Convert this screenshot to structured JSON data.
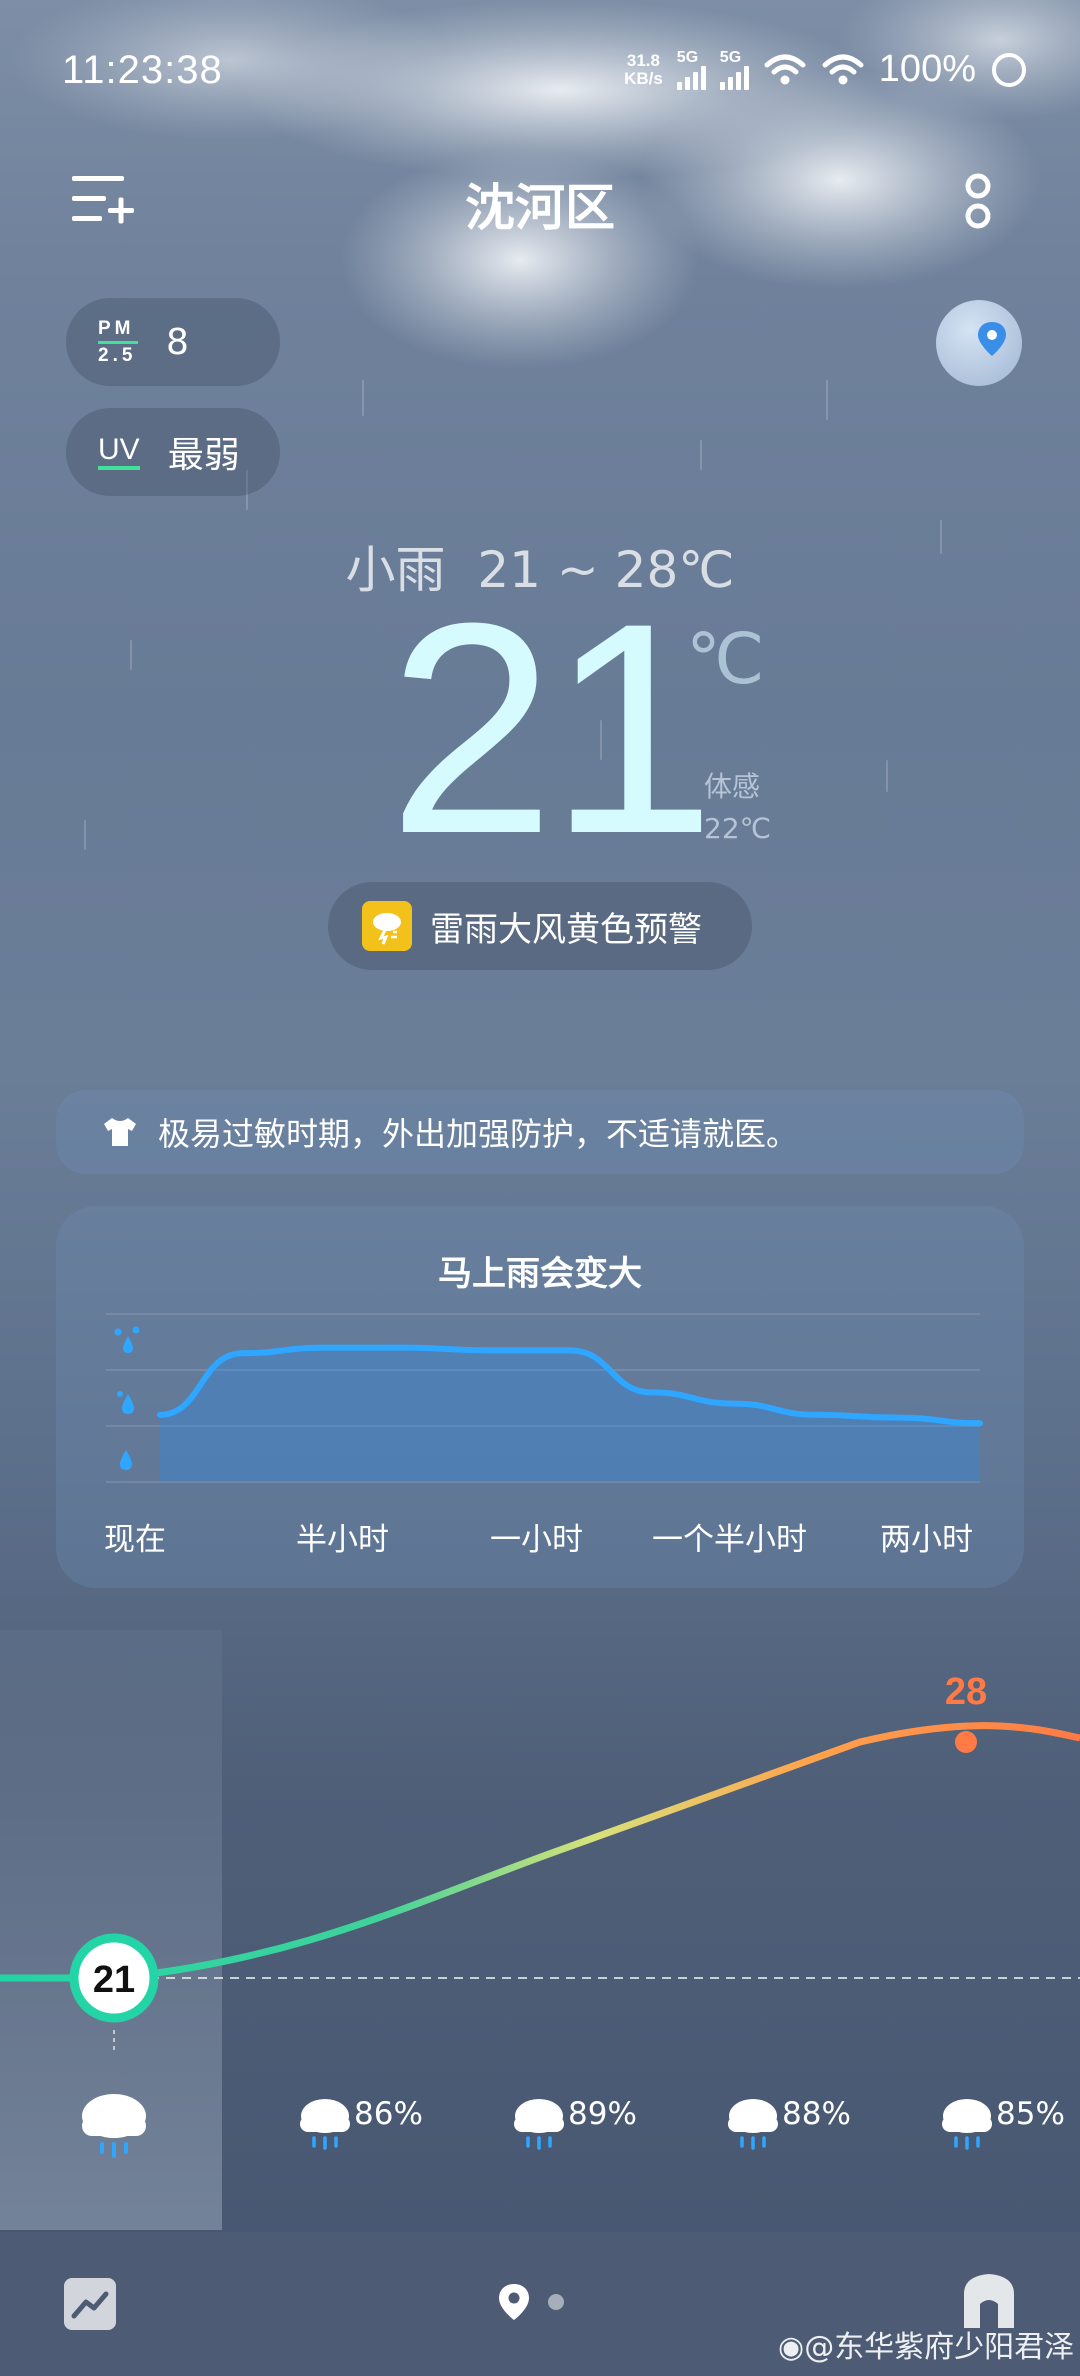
{
  "status_bar": {
    "time": "11:23:38",
    "net_speed_value": "31.8",
    "net_speed_unit": "KB/s",
    "sim1": "5G",
    "sim2": "5G",
    "battery": "100%"
  },
  "header": {
    "city": "沈河区"
  },
  "air": {
    "pm_label_top": "PM",
    "pm_label_bottom": "2.5",
    "pm_value": "8",
    "uv_label": "UV",
    "uv_value": "最弱"
  },
  "current": {
    "condition": "小雨",
    "range": "21 ~ 28℃",
    "temperature": "21",
    "unit": "℃",
    "feels_label": "体感",
    "feels_value": "22℃",
    "warning": "雷雨大风黄色预警"
  },
  "tip": {
    "text": "极易过敏时期，外出加强防护，不适请就医。"
  },
  "rain_forecast": {
    "title": "马上雨会变大",
    "x_labels": [
      "现在",
      "半小时",
      "一小时",
      "一个半小时",
      "两小时"
    ]
  },
  "chart_data": {
    "type": "area",
    "title": "马上雨会变大",
    "x": [
      "现在",
      "半小时",
      "一小时",
      "一个半小时",
      "两小时"
    ],
    "y_levels": [
      "小雨",
      "中雨",
      "大雨"
    ],
    "series": [
      {
        "values": [
          1.2,
          2.3,
          2.4,
          2.4,
          2.35,
          2.35,
          1.6,
          1.4,
          1.2,
          1.15,
          1.05
        ]
      }
    ],
    "grid": true
  },
  "hourly": {
    "now_temp": "21",
    "max_temp": "28",
    "items": [
      {
        "pct": ""
      },
      {
        "pct": "86%"
      },
      {
        "pct": "89%"
      },
      {
        "pct": "88%"
      },
      {
        "pct": "85%"
      }
    ]
  },
  "watermark": "@东华紫府少阳君泽",
  "colors": {
    "accent_green": "#42e09a",
    "temp_high": "#ff7a45",
    "warning_yellow": "#f2c21b",
    "rain_blue": "#2fa6ff"
  }
}
